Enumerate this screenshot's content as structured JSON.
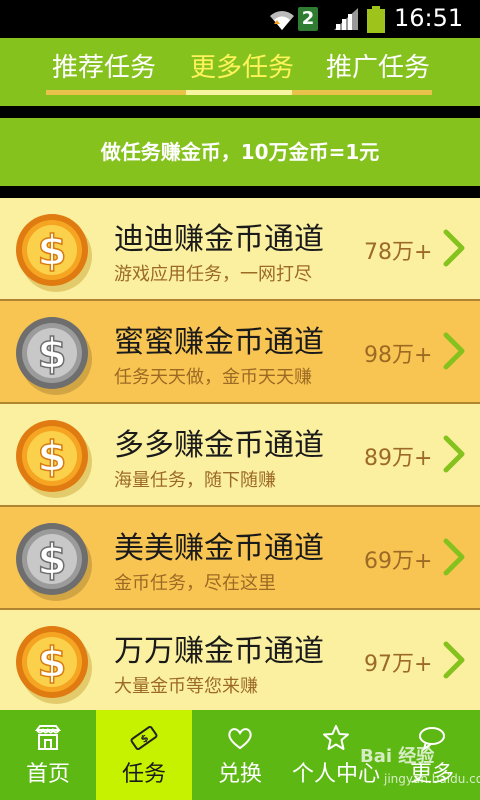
{
  "status_bar": {
    "notification_count": "2",
    "time": "16:51"
  },
  "tabs": [
    {
      "label": "推荐任务",
      "active": false
    },
    {
      "label": "更多任务",
      "active": true
    },
    {
      "label": "推广任务",
      "active": false
    }
  ],
  "banner": {
    "text": "做任务赚金币，10万金币=1元"
  },
  "colors": {
    "green": "#86c21e",
    "active_tab_text": "#fff35b",
    "row_light": "#fbf0a0",
    "row_dark": "#f9c552",
    "bottom_nav": "#5db814",
    "bottom_nav_active": "#c6f200"
  },
  "channels": [
    {
      "title": "迪迪赚金币通道",
      "subtitle": "游戏应用任务，一网打尽",
      "count": "78万+",
      "coin": "gold-coin-icon"
    },
    {
      "title": "蜜蜜赚金币通道",
      "subtitle": "任务天天做，金币天天赚",
      "count": "98万+",
      "coin": "silver-coin-icon"
    },
    {
      "title": "多多赚金币通道",
      "subtitle": "海量任务，随下随赚",
      "count": "89万+",
      "coin": "gold-coin-icon"
    },
    {
      "title": "美美赚金币通道",
      "subtitle": "金币任务，尽在这里",
      "count": "69万+",
      "coin": "silver-coin-icon"
    },
    {
      "title": "万万赚金币通道",
      "subtitle": "大量金币等您来赚",
      "count": "97万+",
      "coin": "gold-coin-icon"
    }
  ],
  "bottom_nav": [
    {
      "label": "首页",
      "icon": "store-icon",
      "active": false
    },
    {
      "label": "任务",
      "icon": "task-ticket-icon",
      "active": true
    },
    {
      "label": "兑换",
      "icon": "heart-icon",
      "active": false
    },
    {
      "label": "个人中心",
      "icon": "star-icon",
      "active": false
    },
    {
      "label": "更多",
      "icon": "chat-bubble-icon",
      "active": false
    }
  ],
  "watermark": {
    "main": "Bai 经验",
    "sub": "jingyan.baidu.com"
  }
}
